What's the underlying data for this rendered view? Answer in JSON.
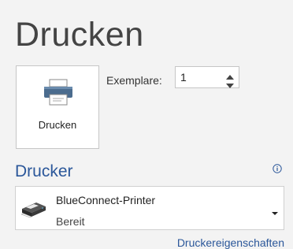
{
  "page": {
    "title": "Drucken"
  },
  "print_button": {
    "label": "Drucken"
  },
  "copies": {
    "label": "Exemplare:",
    "value": "1"
  },
  "printer_section": {
    "title": "Drucker",
    "selected_printer": {
      "name": "BlueConnect-Printer",
      "status": "Bereit"
    },
    "properties_link": "Druckereigenschaften"
  },
  "colors": {
    "accent": "#2b579a",
    "title_text": "#444444",
    "background": "#f3f3f3"
  }
}
